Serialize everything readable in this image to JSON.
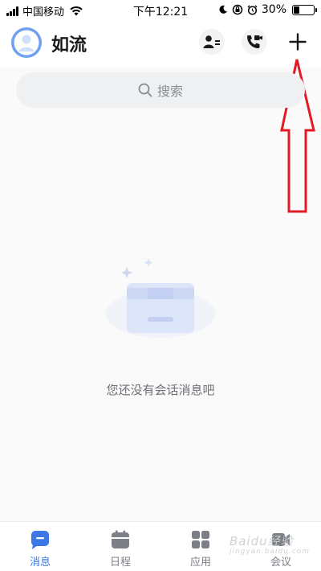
{
  "status_bar": {
    "carrier": "中国移动",
    "time": "下午12:21",
    "battery": "30%",
    "battery_level": 0.3
  },
  "header": {
    "title": "如流",
    "icons": {
      "avatar": "user-avatar",
      "contacts": "contacts-icon",
      "call": "video-call-icon",
      "add": "plus-icon"
    }
  },
  "search": {
    "placeholder": "搜索"
  },
  "empty_state": {
    "message": "您还没有会话消息吧"
  },
  "tabbar": {
    "tabs": [
      {
        "label": "消息",
        "icon": "message-icon",
        "active": true
      },
      {
        "label": "日程",
        "icon": "calendar-icon",
        "active": false
      },
      {
        "label": "应用",
        "icon": "apps-icon",
        "active": false
      },
      {
        "label": "会议",
        "icon": "meeting-icon",
        "active": false
      }
    ]
  },
  "colors": {
    "accent": "#3c78e6",
    "annotation_red": "#e01b24"
  },
  "watermark": {
    "text": "Baidu经验",
    "url_text": "jingyan.baidu.com"
  }
}
